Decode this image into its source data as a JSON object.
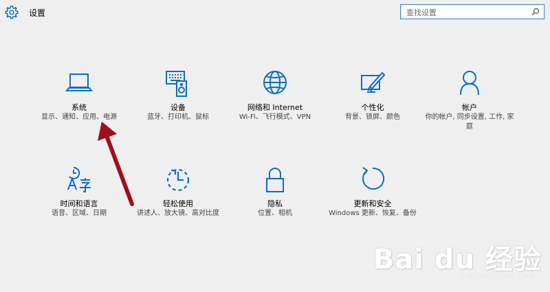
{
  "header": {
    "title": "设置"
  },
  "search": {
    "placeholder": "查找设置"
  },
  "tiles": [
    {
      "name": "系统",
      "desc": "显示、通知、应用、电源",
      "icon": "laptop-icon"
    },
    {
      "name": "设备",
      "desc": "蓝牙、打印机、鼠标",
      "icon": "devices-icon"
    },
    {
      "name": "网络和 Internet",
      "desc": "Wi-Fi、飞行模式、VPN",
      "icon": "globe-icon"
    },
    {
      "name": "个性化",
      "desc": "背景、锁屏、颜色",
      "icon": "personalization-icon"
    },
    {
      "name": "帐户",
      "desc": "你的帐户, 同步设置, 工作, 家庭",
      "icon": "person-icon"
    },
    {
      "name": "时间和语言",
      "desc": "语音、区域、日期",
      "icon": "time-language-icon"
    },
    {
      "name": "轻松使用",
      "desc": "讲述人、放大镜、高对比度",
      "icon": "ease-of-access-icon"
    },
    {
      "name": "隐私",
      "desc": "位置、相机",
      "icon": "lock-icon"
    },
    {
      "name": "更新和安全",
      "desc": "Windows 更新、恢复、备份",
      "icon": "refresh-icon"
    }
  ],
  "colors": {
    "accent": "#0a6ec8",
    "arrow": "#a00f18",
    "background": "#efefef"
  },
  "watermark": {
    "logo": "Bai du 经验",
    "url": "jingyan.baidu.com"
  }
}
